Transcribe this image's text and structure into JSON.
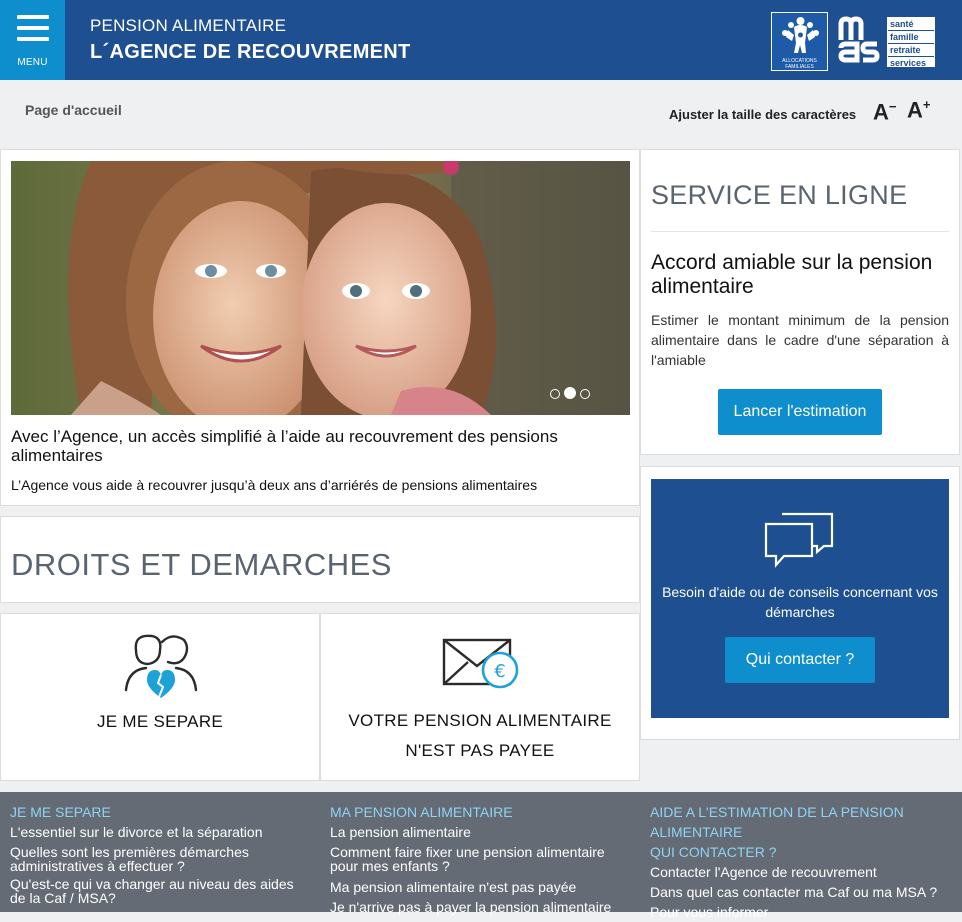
{
  "header": {
    "menu_label": "MENU",
    "subtitle": "PENSION ALIMENTAIRE",
    "title": "L´AGENCE DE RECOUVREMENT",
    "caf_logo_text": "ALLOCATIONS FAMILIALES",
    "msa_letters": "msa",
    "msa_words": [
      "santé",
      "famille",
      "retraite",
      "services"
    ]
  },
  "breadcrumb": "Page d'accueil",
  "font_size": {
    "label": "Ajuster la taille des caractères",
    "decrease": "A",
    "decrease_sup": "−",
    "increase": "A",
    "increase_sup": "+"
  },
  "hero": {
    "title": "Avec l’Agence, un accès simplifié à l’aide au recouvrement des pensions alimentaires",
    "text": "L’Agence vous aide à recouvrer jusqu’à deux ans d’arriérés de pensions alimentaires",
    "slides": 3,
    "active_slide": 2
  },
  "service": {
    "title": "SERVICE EN LIGNE",
    "subtitle": "Accord amiable sur la pension alimentaire",
    "description": "Estimer le montant minimum de la pension alimentaire dans le cadre d'une séparation à l'amiable",
    "button": "Lancer l'estimation"
  },
  "droits": {
    "title": "DROITS ET DEMARCHES"
  },
  "cards": [
    {
      "line1": "JE ME SEPARE",
      "line2": "",
      "icon": "broken-heart-couple-icon"
    },
    {
      "line1": "VOTRE PENSION ALIMENTAIRE",
      "line2": "N'EST PAS PAYEE",
      "icon": "euro-envelope-icon"
    }
  ],
  "help": {
    "text": "Besoin d'aide ou de conseils concernant vos démarches",
    "button": "Qui contacter ?",
    "icon": "chat-bubbles-icon"
  },
  "footer": {
    "col1": {
      "heading": "JE ME SEPARE",
      "links": [
        "L'essentiel sur le divorce et la séparation",
        "Quelles sont les premières démarches administratives à effectuer ?",
        "Qu'est-ce qui va changer au niveau des aides de la Caf / MSA?"
      ]
    },
    "col2": {
      "heading": "MA PENSION ALIMENTAIRE",
      "links": [
        "La pension alimentaire",
        "Comment faire fixer une pension alimentaire pour mes enfants ?",
        "Ma pension alimentaire n'est pas payée",
        "Je n'arrive pas à payer la pension alimentaire"
      ]
    },
    "col3": {
      "heading": "AIDE A L'ESTIMATION DE LA PENSION ALIMENTAIRE",
      "heading2": "QUI CONTACTER ?",
      "links": [
        "Contacter l'Agence de recouvrement",
        "Dans quel cas contacter ma Caf ou ma MSA ?",
        "Pour vous informer"
      ]
    }
  },
  "colors": {
    "header_blue": "#1d4f91",
    "accent_blue": "#0e8ecd",
    "footer_gray": "#646b75",
    "footer_heading": "#8fd3f3"
  }
}
